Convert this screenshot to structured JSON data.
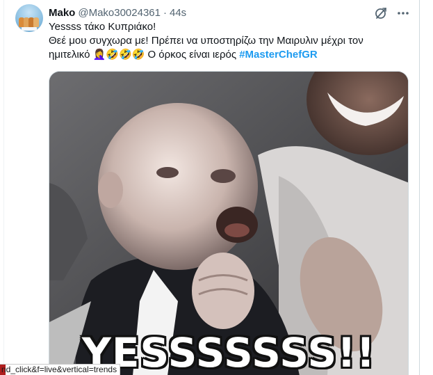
{
  "tweet": {
    "author_name": "Mako",
    "handle": "@Mako30024361",
    "separator": "·",
    "time": "44s",
    "lines": [
      "Yessss τάκο Κυπριάκο!",
      "Θεέ μου συγχωρα με! Πρέπει να υποστηρίζω την Μαιρυλιν μέχρι τον",
      "ημιτελικό 🤦‍♀️🤣🤣🤣 Ο όρκος είναι ιερός "
    ],
    "hashtag": "#MasterChefGR",
    "media": {
      "caption": "YESSSSSSS!!",
      "description_icon": "baby-yes-gif"
    },
    "icons": {
      "grok": "grok-icon",
      "more": "more-options-icon",
      "avatar": "avatar-image"
    }
  },
  "browser": {
    "status_url": "nd_click&f=live&vertical=trends"
  },
  "colors": {
    "accent": "#1d9bf0",
    "text": "#0f1419",
    "secondary": "#536471"
  }
}
